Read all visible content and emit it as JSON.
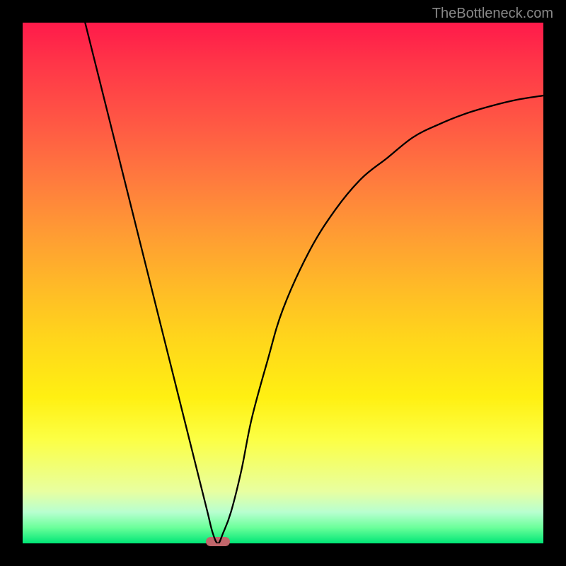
{
  "watermark": "TheBottleneck.com",
  "chart_data": {
    "type": "line",
    "title": "",
    "xlabel": "",
    "ylabel": "",
    "x_range": [
      0,
      100
    ],
    "y_range": [
      0,
      100
    ],
    "series": [
      {
        "name": "curve",
        "x": [
          12,
          15,
          18,
          21,
          24,
          27,
          30,
          32,
          34,
          35.5,
          36.5,
          37.5,
          38.5,
          40,
          42,
          44,
          47,
          50,
          55,
          60,
          65,
          70,
          75,
          80,
          85,
          90,
          95,
          100
        ],
        "y": [
          100,
          88,
          76,
          64,
          52,
          40,
          28,
          20,
          12,
          6,
          2,
          0,
          2,
          6,
          14,
          24,
          35,
          45,
          56,
          64,
          70,
          74,
          78,
          80.5,
          82.5,
          84,
          85.2,
          86
        ]
      }
    ],
    "marker": {
      "x": 37.5,
      "y": 0,
      "color": "#c1666b"
    },
    "gradient_background": {
      "top_color": "#ff1a4a",
      "mid_color": "#ffe600",
      "bottom_color": "#00e676"
    }
  }
}
